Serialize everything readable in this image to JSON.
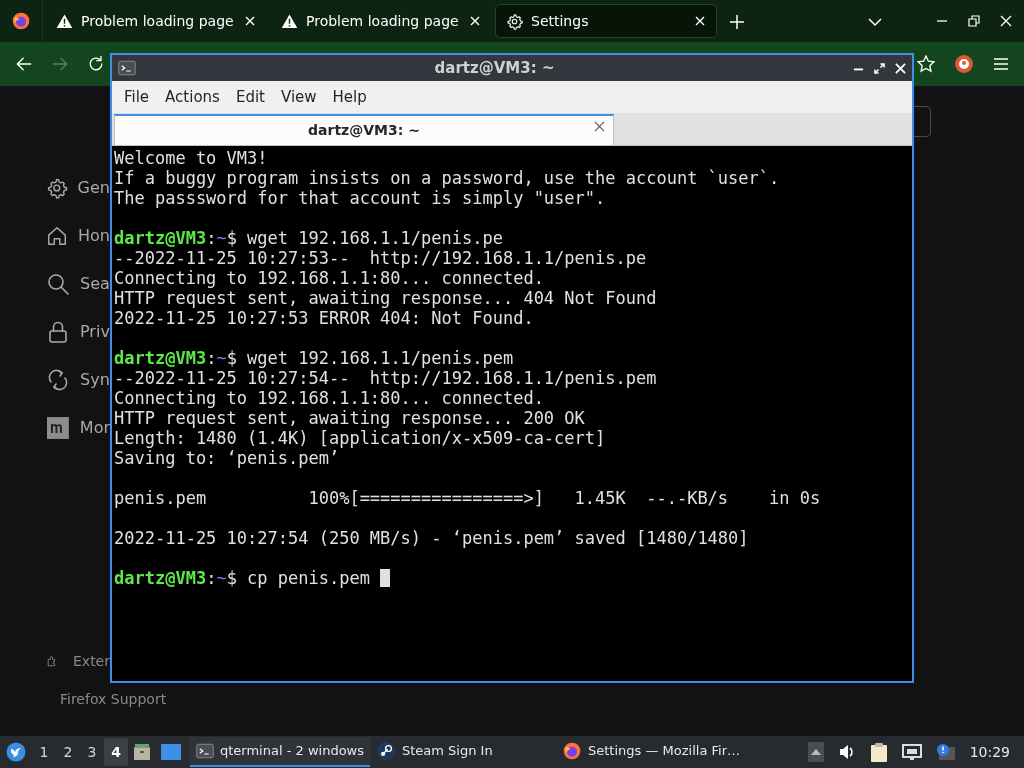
{
  "browser": {
    "tabs": [
      {
        "kind": "warning",
        "label": "Problem loading page",
        "selected": false
      },
      {
        "kind": "warning",
        "label": "Problem loading page",
        "selected": false
      },
      {
        "kind": "gear",
        "label": "Settings",
        "selected": true
      }
    ],
    "nav_buttons": [
      {
        "kind": "back",
        "disabled": false
      },
      {
        "kind": "forward",
        "disabled": true
      },
      {
        "kind": "reload",
        "disabled": false
      }
    ],
    "settings_sidebar": {
      "items": [
        {
          "kind": "gear",
          "label": "Gen"
        },
        {
          "kind": "home",
          "label": "Hon"
        },
        {
          "kind": "search",
          "label": "Sea"
        },
        {
          "kind": "lock",
          "label": "Priv"
        },
        {
          "kind": "sync",
          "label": "Syn"
        },
        {
          "kind": "more",
          "label": "Mor"
        }
      ],
      "footer_items": [
        {
          "kind": "puzzle",
          "label": "Exter"
        },
        {
          "kind": "help",
          "label": "Firefox Support"
        }
      ]
    }
  },
  "terminal": {
    "title": "dartz@VM3: ~",
    "menu": [
      "File",
      "Actions",
      "Edit",
      "View",
      "Help"
    ],
    "tabs": [
      {
        "label": "dartz@VM3: ~",
        "selected": true
      }
    ],
    "lines": [
      {
        "kind": "output",
        "text": "Welcome to VM3!"
      },
      {
        "kind": "output",
        "text": "If a buggy program insists on a password, use the account `user`."
      },
      {
        "kind": "output",
        "text": "The passsword for that account is simply \"user\"."
      },
      {
        "kind": "blank"
      },
      {
        "kind": "prompt",
        "user": "dartz@VM3",
        "colon": ":",
        "path": "~",
        "command": "$ wget 192.168.1.1/penis.pe"
      },
      {
        "kind": "output",
        "text": "--2022-11-25 10:27:53--  http://192.168.1.1/penis.pe"
      },
      {
        "kind": "output",
        "text": "Connecting to 192.168.1.1:80... connected."
      },
      {
        "kind": "output",
        "text": "HTTP request sent, awaiting response... 404 Not Found"
      },
      {
        "kind": "output",
        "text": "2022-11-25 10:27:53 ERROR 404: Not Found."
      },
      {
        "kind": "blank"
      },
      {
        "kind": "prompt",
        "user": "dartz@VM3",
        "colon": ":",
        "path": "~",
        "command": "$ wget 192.168.1.1/penis.pem"
      },
      {
        "kind": "output",
        "text": "--2022-11-25 10:27:54--  http://192.168.1.1/penis.pem"
      },
      {
        "kind": "output",
        "text": "Connecting to 192.168.1.1:80... connected."
      },
      {
        "kind": "output",
        "text": "HTTP request sent, awaiting response... 200 OK"
      },
      {
        "kind": "output",
        "text": "Length: 1480 (1.4K) [application/x-x509-ca-cert]"
      },
      {
        "kind": "output",
        "text": "Saving to: ‘penis.pem’"
      },
      {
        "kind": "blank"
      },
      {
        "kind": "output",
        "text": "penis.pem          100%[================>]   1.45K  --.-KB/s    in 0s"
      },
      {
        "kind": "blank"
      },
      {
        "kind": "output",
        "text": "2022-11-25 10:27:54 (250 MB/s) - ‘penis.pem’ saved [1480/1480]"
      },
      {
        "kind": "blank"
      },
      {
        "kind": "prompt",
        "user": "dartz@VM3",
        "colon": ":",
        "path": "~",
        "command": "$ cp penis.pem",
        "cursor": true
      }
    ]
  },
  "taskbar": {
    "workspaces": [
      {
        "label": "1",
        "selected": false
      },
      {
        "label": "2",
        "selected": false
      },
      {
        "label": "3",
        "selected": false
      },
      {
        "label": "4",
        "selected": true
      }
    ],
    "tasks": [
      {
        "kind": "terminal",
        "label": "qterminal - 2 windows",
        "selected": true
      },
      {
        "kind": "steam",
        "label": "Steam Sign In",
        "selected": false
      },
      {
        "kind": "firefox",
        "label": "Settings — Mozilla Fir…",
        "selected": false
      }
    ],
    "clock": "10:29"
  }
}
